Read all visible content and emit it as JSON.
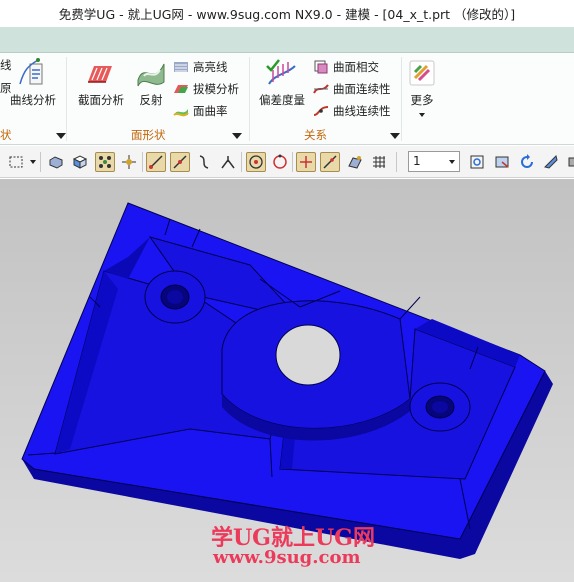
{
  "window": {
    "title": "免费学UG - 就上UG网 - www.9sug.com NX9.0 - 建模 - [04_x_t.prt （修改的）]"
  },
  "ribbon": {
    "left_edge": {
      "line1": "线",
      "line2": "原",
      "group_fragment": "状"
    },
    "curve_analysis_label": "曲线分析",
    "face_shape_group": {
      "label": "面形状",
      "big_buttons": [
        {
          "label": "截面分析",
          "icon": "section-analysis-icon"
        },
        {
          "label": "反射",
          "icon": "reflection-icon"
        }
      ],
      "small_buttons": [
        {
          "label": "高亮线",
          "icon": "highlight-lines-icon"
        },
        {
          "label": "拔模分析",
          "icon": "draft-analysis-icon"
        },
        {
          "label": "面曲率",
          "icon": "face-curvature-icon"
        }
      ]
    },
    "relation_group": {
      "label": "关系",
      "big_button": {
        "label": "偏差度量",
        "icon": "deviation-gauge-icon"
      },
      "small_buttons": [
        {
          "label": "曲面相交",
          "icon": "face-intersect-icon"
        },
        {
          "label": "曲面连续性",
          "icon": "surface-continuity-icon"
        },
        {
          "label": "曲线连续性",
          "icon": "curve-continuity-icon"
        }
      ]
    },
    "more_button": {
      "label": "更多",
      "icon": "more-gallery-icon"
    }
  },
  "toolbar": {
    "layer_value": "1",
    "icons": [
      "select-box-icon",
      "select-solid-icon",
      "select-face-icon",
      "select-components-icon",
      "snap-endpoint-icon",
      "snap-midpoint-icon",
      "snap-control-icon",
      "snap-intersection-icon",
      "snap-center-icon",
      "snap-quadrant-icon",
      "snap-point-icon",
      "snap-onCurve-icon",
      "snap-onface-icon",
      "grid-icon",
      "fit-view-icon",
      "shaded-view-icon",
      "rotate-view-icon",
      "display-edit-icon"
    ]
  },
  "viewport": {
    "model_color": "#1a14f2",
    "background": "#cccccc",
    "watermark_line1": "学UG就上UG网",
    "watermark_line2": "www.9sug.com"
  }
}
